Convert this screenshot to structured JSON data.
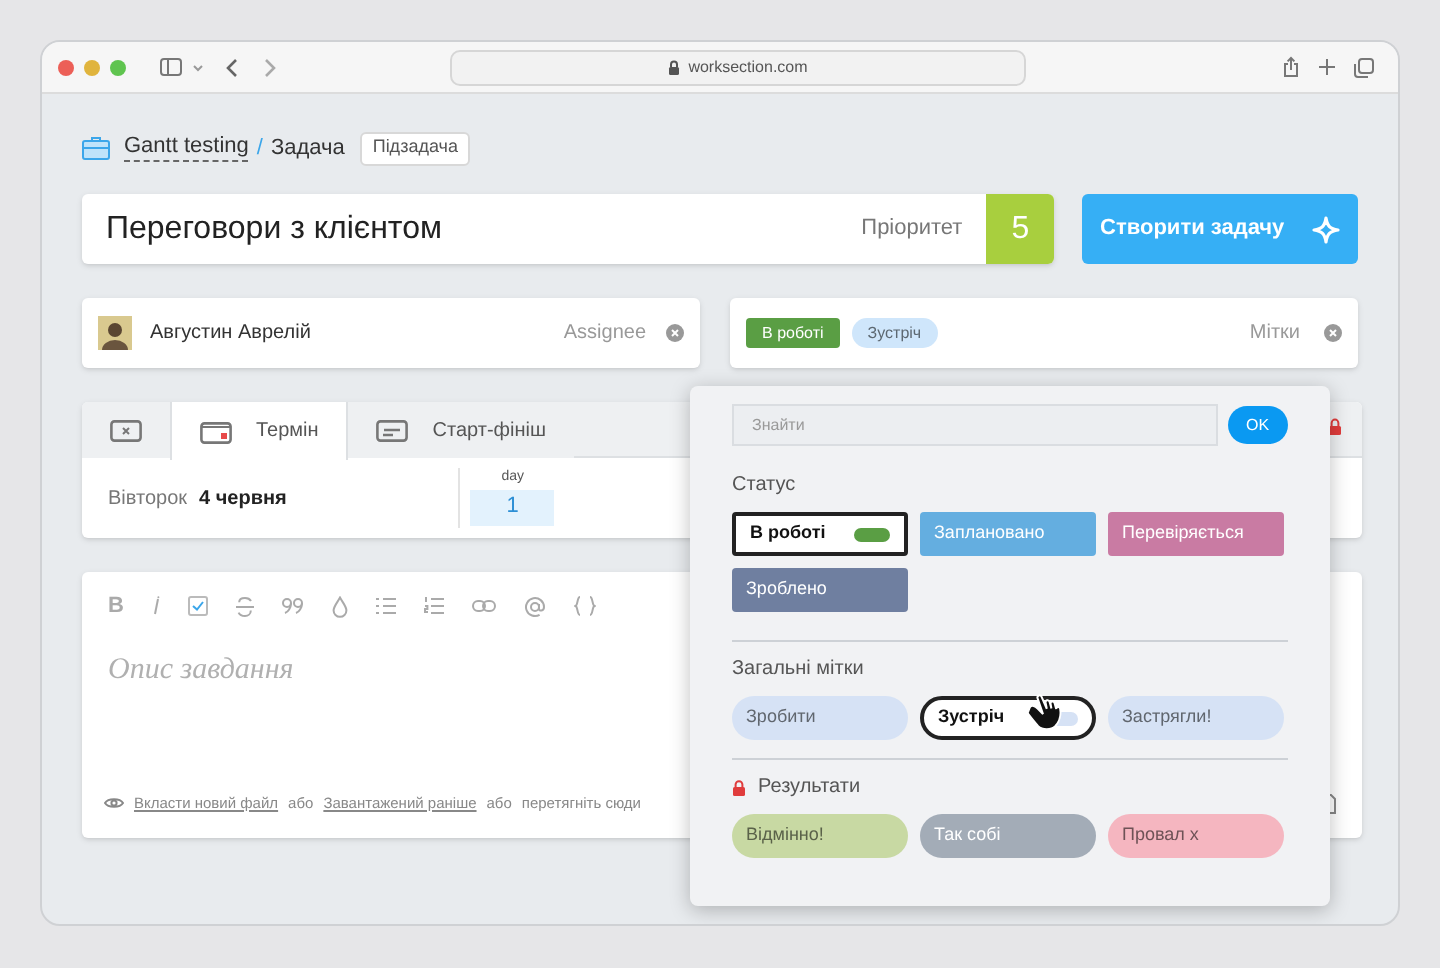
{
  "browser": {
    "url": "worksection.com"
  },
  "breadcrumb": {
    "project": "Gantt testing",
    "separator": "/",
    "current": "Задача",
    "subtask_button": "Підзадача"
  },
  "task": {
    "title": "Переговори з клієнтом",
    "priority_label": "Пріоритет",
    "priority": "5",
    "create_button": "Створити задачу"
  },
  "assignee": {
    "name": "Августин Аврелій",
    "label": "Assignee"
  },
  "tags_field": {
    "tags": [
      {
        "label": "В роботі",
        "color": "#5a9e44"
      },
      {
        "label": "Зустріч",
        "color": "#cfe6fb"
      }
    ],
    "label": "Мітки"
  },
  "date_tabs": [
    {
      "selected": false,
      "kind": "none"
    },
    {
      "label": "Термін",
      "selected": true,
      "kind": "deadline"
    },
    {
      "label": "Старт-фініш",
      "selected": false,
      "kind": "range"
    }
  ],
  "date": {
    "weekday": "Вівторок",
    "date": "4 червня",
    "day_label": "day",
    "day": "1"
  },
  "editor": {
    "bold_button": "B",
    "placeholder": "Опис завдання",
    "attach_link": "Вкласти новий файл",
    "or_1": "або",
    "uploaded_link": "Завантажений раніше",
    "or_2": "або",
    "drag_text": "перетягніть сюди"
  },
  "tag_popup": {
    "search_placeholder": "Знайти",
    "ok_button": "OK",
    "groups": [
      {
        "title": "Статус",
        "kind": "status",
        "locked": false,
        "items": [
          {
            "label": "В роботі",
            "color": "#5a9e44",
            "selected": true
          },
          {
            "label": "Заплановано",
            "color": "#64aee0",
            "selected": false
          },
          {
            "label": "Перевіряється",
            "color": "#c97ba3",
            "selected": false
          },
          {
            "label": "Зроблено",
            "color": "#6f7fa0",
            "selected": false
          }
        ]
      },
      {
        "title": "Загальні мітки",
        "kind": "tag",
        "locked": false,
        "items": [
          {
            "label": "Зробити",
            "color": "#d6e2f5",
            "selected": false
          },
          {
            "label": "Зустріч",
            "color": "#d6e2f5",
            "selected": true
          },
          {
            "label": "Застрягли!",
            "color": "#d6e2f5",
            "selected": false
          }
        ]
      },
      {
        "title": "Результати",
        "kind": "tag",
        "locked": true,
        "items": [
          {
            "label": "Відмінно!",
            "color": "#c8d9a3",
            "selected": false
          },
          {
            "label": "Так собі",
            "color": "#a3acb7",
            "selected": false
          },
          {
            "label": "Провал х",
            "color": "#f5b6c0",
            "selected": false
          }
        ]
      }
    ]
  }
}
